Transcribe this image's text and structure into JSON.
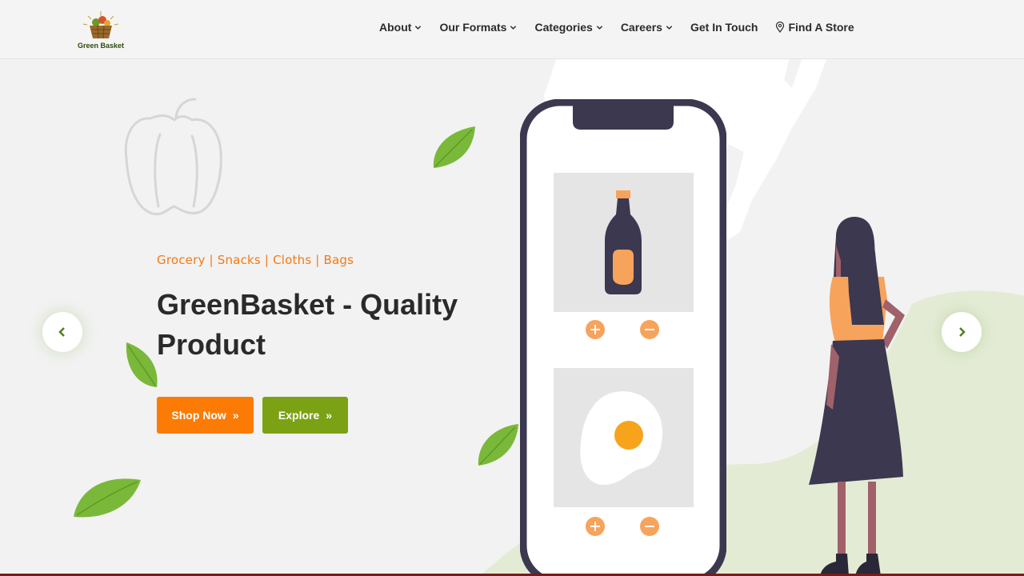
{
  "brand": {
    "name": "Green Basket"
  },
  "nav": {
    "items": [
      {
        "label": "About",
        "dropdown": true
      },
      {
        "label": "Our Formats",
        "dropdown": true
      },
      {
        "label": "Categories",
        "dropdown": true
      },
      {
        "label": "Careers",
        "dropdown": true
      },
      {
        "label": "Get In Touch",
        "dropdown": false
      },
      {
        "label": "Find A Store",
        "dropdown": false,
        "icon": "map-pin-icon"
      }
    ]
  },
  "hero": {
    "tagline": "Grocery | Snacks | Cloths | Bags",
    "headline": "GreenBasket - Quality Product",
    "shop_label": "Shop Now",
    "explore_label": "Explore"
  },
  "carousel": {
    "prev_icon": "chevron-left-icon",
    "next_icon": "chevron-right-icon"
  },
  "colors": {
    "accent_orange": "#fb7b05",
    "accent_green": "#7ba214",
    "tagline": "#f27a14",
    "phone_frame": "#3b3850"
  }
}
